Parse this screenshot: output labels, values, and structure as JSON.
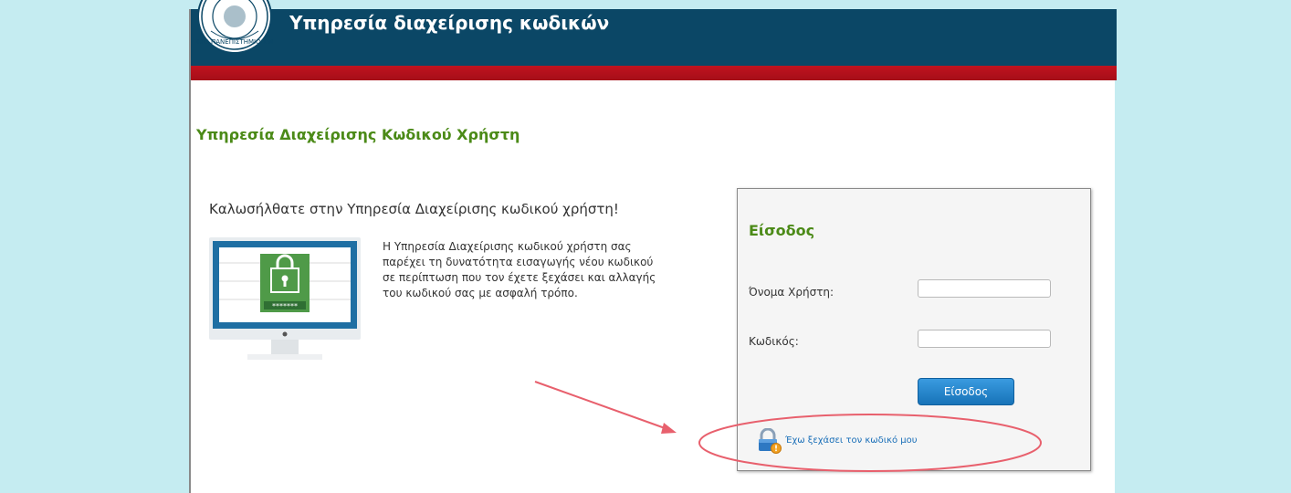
{
  "header": {
    "title": "Υπηρεσία διαχείρισης κωδικών",
    "logo_icon": "university-seal-icon",
    "bg_color": "#0b4766",
    "stripe_color": "#c0131f"
  },
  "main": {
    "heading": "Υπηρεσία Διαχείρισης Κωδικού Χρήστη",
    "welcome": "Καλωσήλθατε στην Υπηρεσία Διαχείρισης κωδικού χρήστη!",
    "illustration_icon": "monitor-padlock-icon",
    "description": "Η Υπηρεσία Διαχείρισης κωδικού χρήστη σας παρέχει τη δυνατότητα εισαγωγής νέου κωδικού σε περίπτωση που τον έχετε ξεχάσει και αλλαγής του κωδικού σας με ασφαλή τρόπο.",
    "illustration_password_mask": "*******"
  },
  "login": {
    "title": "Είσοδος",
    "username_label": "Όνομα Χρήστη:",
    "username_value": "",
    "password_label": "Κωδικός:",
    "password_value": "",
    "submit_label": "Είσοδος",
    "forgot_link": "Έχω ξεχάσει τον κωδικό μου",
    "forgot_icon": "lock-warning-icon"
  },
  "annotation": {
    "arrow_color": "#e8606d",
    "ellipse_color": "#e8606d"
  }
}
